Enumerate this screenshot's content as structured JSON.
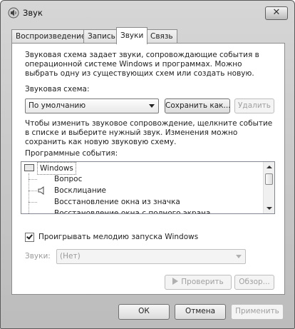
{
  "window": {
    "title": "Звук",
    "close_label": "✕"
  },
  "tabs": [
    {
      "label": "Воспроизведение"
    },
    {
      "label": "Запись"
    },
    {
      "label": "Звуки"
    },
    {
      "label": "Связь"
    }
  ],
  "sounds": {
    "intro": "Звуковая схема задает звуки, сопровождающие события в операционной системе Windows и программах. Можно выбрать одну из существующих схем или создать новую.",
    "scheme_label": "Звуковая схема:",
    "scheme_value": "По умолчанию",
    "save_as_label": "Сохранить как...",
    "delete_label": "Удалить",
    "instructions": "Чтобы изменить звуковое сопровождение, щелкните событие в списке и выберите нужный звук. Изменения можно сохранить как новую звуковую схему.",
    "events_label": "Программные события:",
    "events": {
      "group": "Windows",
      "items": [
        "Вопрос",
        "Восклицание",
        "Восстановление окна из значка",
        "Восстановление окна с полного экрана"
      ]
    },
    "startup_checkbox_label": "Проигрывать мелодию запуска Windows",
    "startup_checked": true,
    "sounds_field_label": "Звуки:",
    "sounds_field_value": "(Нет)",
    "test_label": "Проверить",
    "browse_label": "Обзор..."
  },
  "footer": {
    "ok_label": "ОК",
    "cancel_label": "Отмена",
    "apply_label": "Применить"
  }
}
